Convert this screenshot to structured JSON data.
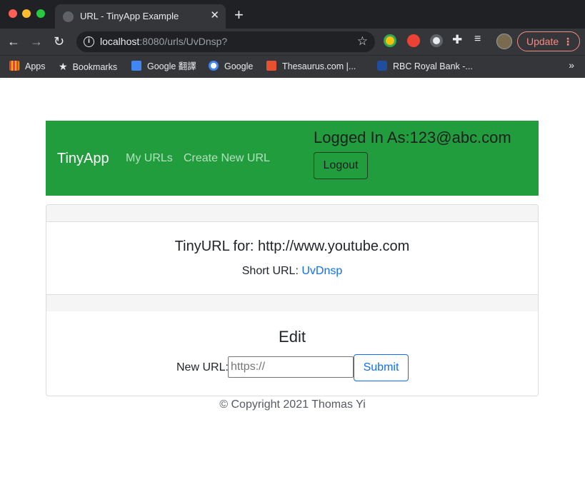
{
  "browser": {
    "tab_title": "URL - TinyApp Example",
    "tab_close": "✕",
    "new_tab": "+",
    "url_host": "localhost",
    "url_path": ":8080/urls/UvDnsp?",
    "update_label": "Update",
    "bookmarks": [
      {
        "label": "Apps"
      },
      {
        "label": "Bookmarks"
      },
      {
        "label": "Google 翻譯"
      },
      {
        "label": "Google"
      },
      {
        "label": "Thesaurus.com |..."
      },
      {
        "label": "RBC Royal Bank -..."
      }
    ],
    "bookmarks_more": "»"
  },
  "navbar": {
    "brand": "TinyApp",
    "links": [
      "My URLs",
      "Create New URL"
    ],
    "logged_in": "Logged In As:123@abc.com",
    "logout": "Logout",
    "color": "#229d3d"
  },
  "card": {
    "title": "TinyURL for: http://www.youtube.com",
    "short_label": "Short URL: ",
    "short_value": "UvDnsp",
    "edit_title": "Edit",
    "new_url_label": "New URL:",
    "new_url_placeholder": "https://",
    "submit": "Submit"
  },
  "footer": {
    "text": "© Copyright 2021 Thomas Yi"
  }
}
